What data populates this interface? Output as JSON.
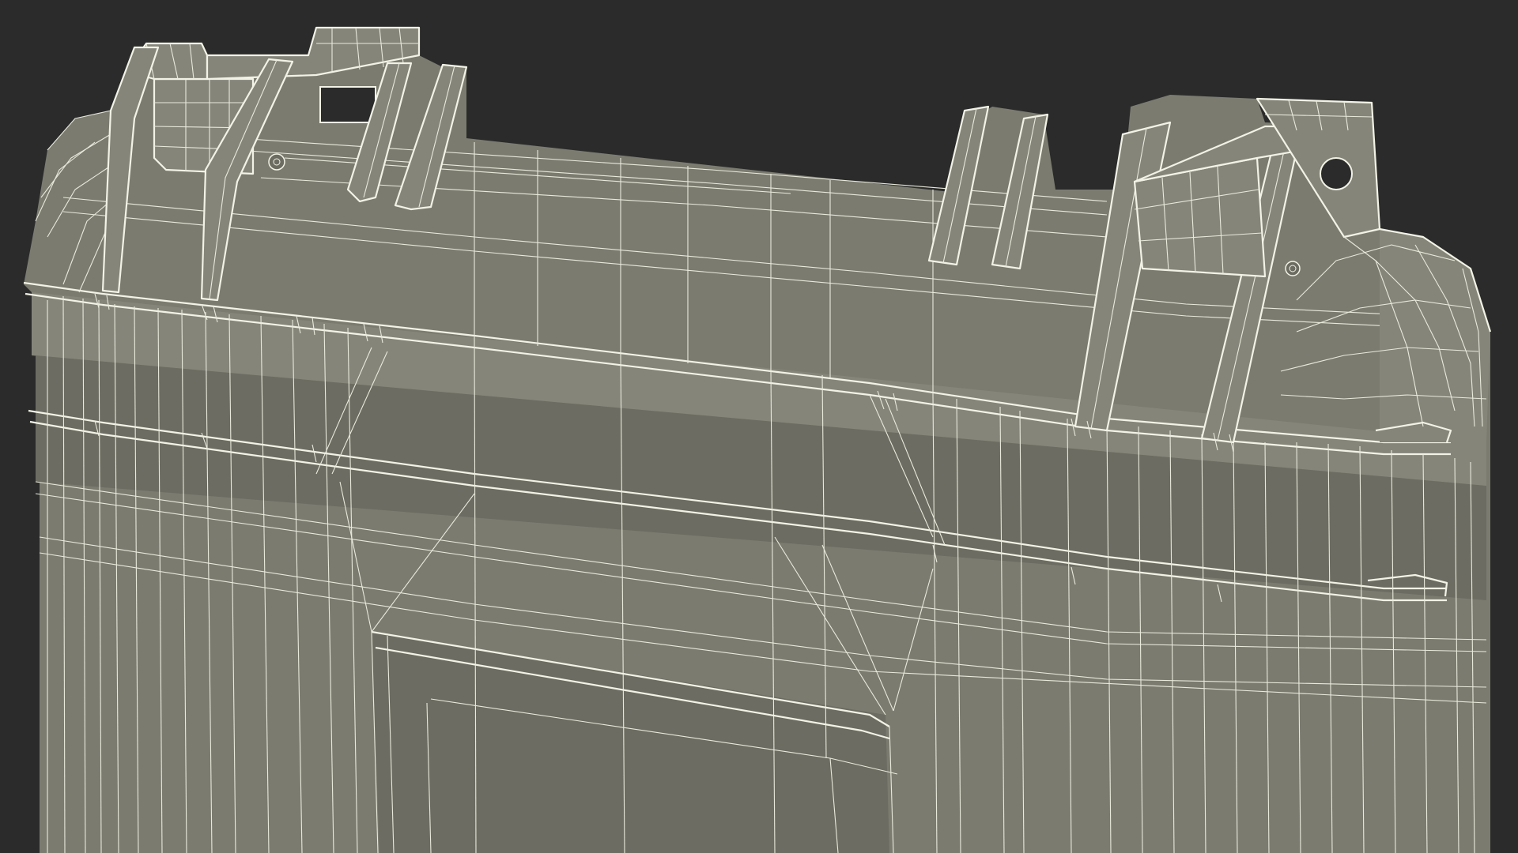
{
  "scene": {
    "subject": "wireframe-hard-case",
    "colors": {
      "background": "#2b2b2b",
      "surface": "#7b7b70",
      "surface_dark": "#6c6c62",
      "surface_light": "#85857a",
      "wireframe": "#e9e9dc"
    }
  }
}
